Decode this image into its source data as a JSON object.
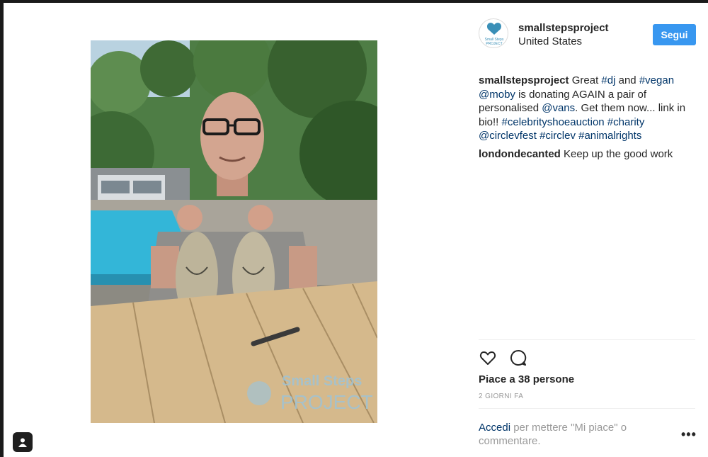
{
  "post": {
    "username": "smallstepsproject",
    "location": "United States",
    "follow_label": "Segui",
    "avatar_icon": "small-steps-logo",
    "avatar_text_1": "Small Steps",
    "avatar_text_2": "PROJECT",
    "watermark_line1": "Small Steps",
    "watermark_line2": "PROJECT"
  },
  "caption": {
    "user": "smallstepsproject",
    "t1": " Great ",
    "tag1": "#dj",
    "t2": " and ",
    "tag2": "#vegan",
    "t3": " ",
    "tag3": "@moby",
    "t4": " is donating AGAIN a pair of personalised ",
    "tag4": "@vans",
    "t5": ". Get them now... link in bio!! ",
    "tag5": "#celebrityshoeauction",
    "t6": " ",
    "tag6": "#charity",
    "t7": " ",
    "tag7": "@circlevfest",
    "t8": " ",
    "tag8": "#circlev",
    "t9": " ",
    "tag9": "#animalrights"
  },
  "comment": {
    "user": "londondecanted",
    "text": " Keep up the good work"
  },
  "likes": "Piace a 38 persone",
  "time": "2 GIORNI FA",
  "login": {
    "link": "Accedi",
    "rest": " per mettere \"Mi piace\" o commentare."
  },
  "more": "•••",
  "colors": {
    "accent": "#3897f0",
    "link": "#003569",
    "muted": "#999999"
  }
}
